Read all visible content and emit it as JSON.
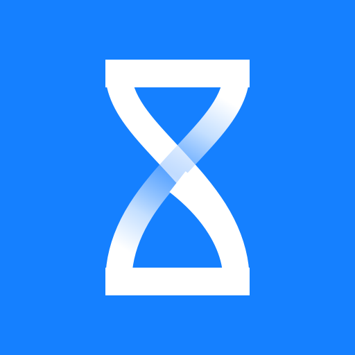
{
  "app_icon": {
    "icon": "hourglass-icon",
    "colors": {
      "background": "#1580FF",
      "glyph": "#FFFFFF",
      "glyph_fade": "#8FBFFF"
    }
  }
}
